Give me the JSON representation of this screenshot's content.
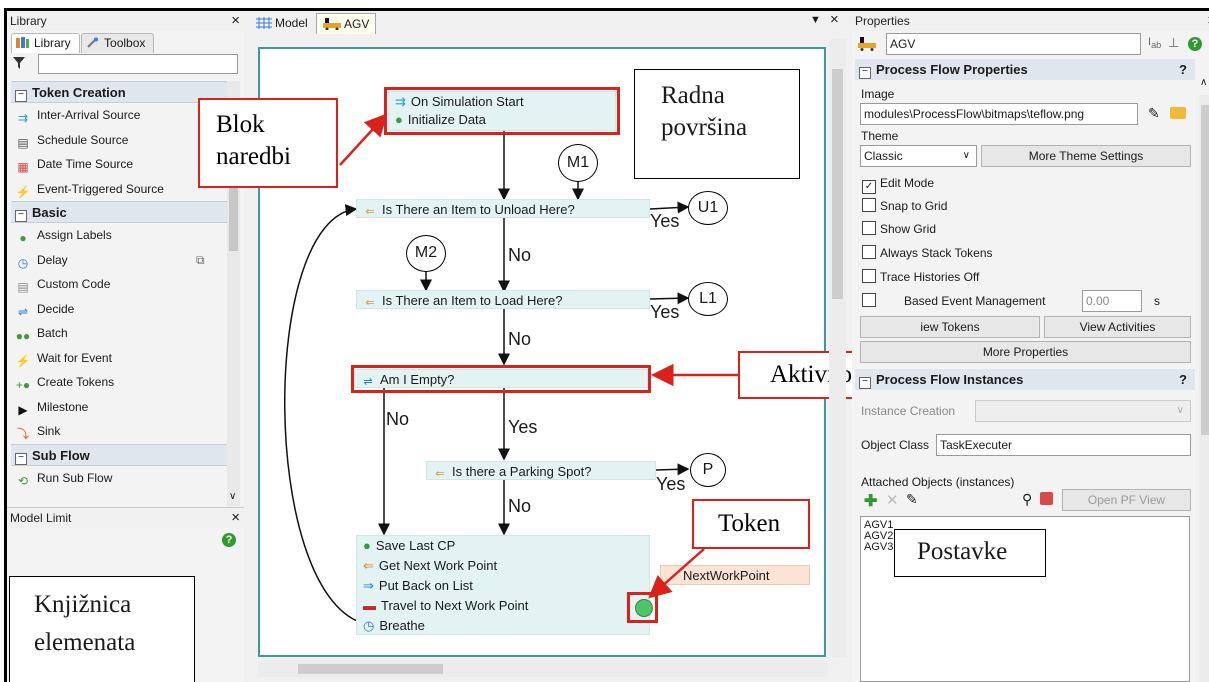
{
  "library": {
    "title": "Library",
    "tabs": [
      "Library",
      "Toolbox"
    ],
    "filter_value": "",
    "categories": [
      {
        "name": "Token Creation",
        "items": [
          "Inter-Arrival Source",
          "Schedule Source",
          "Date Time Source",
          "Event-Triggered Source"
        ]
      },
      {
        "name": "Basic",
        "items": [
          "Assign Labels",
          "Delay",
          "Custom Code",
          "Decide",
          "Batch",
          "Wait for Event",
          "Create Tokens",
          "Milestone",
          "Sink"
        ]
      },
      {
        "name": "Sub Flow",
        "items": [
          "Run Sub Flow"
        ]
      }
    ]
  },
  "model_limit": {
    "title": "Model Limit"
  },
  "center": {
    "tabs": [
      "Model",
      "AGV"
    ],
    "flow": {
      "start_block": [
        "On Simulation Start",
        "Initialize Data"
      ],
      "q_unload": "Is There an Item to Unload Here?",
      "q_load": "Is There an Item to Load Here?",
      "q_empty": "Am I Empty?",
      "q_parking": "Is there a Parking Spot?",
      "end_block": [
        "Save Last CP",
        "Get Next Work Point",
        "Put Back on List",
        "Travel to Next Work Point",
        "Breathe"
      ],
      "label_tag": "NextWorkPoint",
      "yes": "Yes",
      "no": "No",
      "nodes": {
        "m1": "M1",
        "m2": "M2",
        "u1": "U1",
        "l1": "L1",
        "p": "P"
      }
    }
  },
  "annotations": {
    "blok": "Blok naredbi",
    "radna": "Radna površina",
    "aktivnost": "Aktivnost",
    "token": "Token",
    "knjiznica": "Knjižnica elemenata",
    "postavke": "Postavke"
  },
  "properties": {
    "title": "Properties",
    "object_name": "AGV",
    "section1": "Process Flow Properties",
    "image_label": "Image",
    "image_value": "modules\\ProcessFlow\\bitmaps\\teflow.png",
    "theme_label": "Theme",
    "theme_value": "Classic",
    "more_theme": "More Theme Settings",
    "checks": [
      {
        "label": "Edit Mode",
        "checked": true
      },
      {
        "label": "Snap to Grid",
        "checked": false
      },
      {
        "label": "Show Grid",
        "checked": false
      },
      {
        "label": "Always Stack Tokens",
        "checked": false
      },
      {
        "label": "Trace Histories Off",
        "checked": false
      }
    ],
    "event_mgmt_label": "Based Event Management",
    "event_mgmt_value": "0.00",
    "event_mgmt_unit": "s",
    "view_tokens": "iew Tokens",
    "view_activities": "View Activities",
    "more_properties": "More Properties",
    "section2": "Process Flow Instances",
    "instance_creation_label": "Instance Creation",
    "object_class_label": "Object Class",
    "object_class_value": "TaskExecuter",
    "attached_label": "Attached Objects (instances)",
    "open_pf_view": "Open PF View",
    "instances": [
      "AGV1",
      "AGV2",
      "AGV3"
    ]
  }
}
